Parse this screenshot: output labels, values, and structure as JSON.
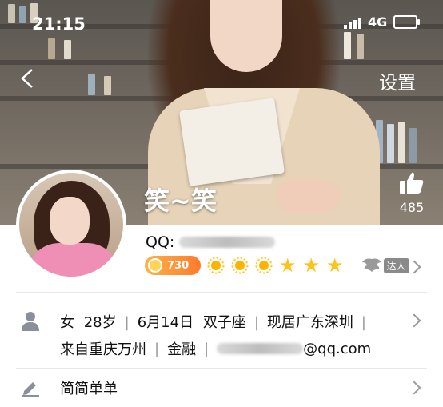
{
  "status_bar": {
    "time": "21:15",
    "network": "4G"
  },
  "header": {
    "settings_label": "设置",
    "nickname": "笑~笑",
    "like_count": "485"
  },
  "profile": {
    "qq_label": "QQ:",
    "vip_level": "730",
    "stars_count": 6,
    "master_label": "达人"
  },
  "details": {
    "gender": "女",
    "age": "28岁",
    "birthday": "6月14日",
    "zodiac": "双子座",
    "location": "现居广东深圳",
    "hometown": "来自重庆万州",
    "industry": "金融",
    "email_suffix": "@qq.com"
  },
  "signature": {
    "text": "简简单单"
  }
}
